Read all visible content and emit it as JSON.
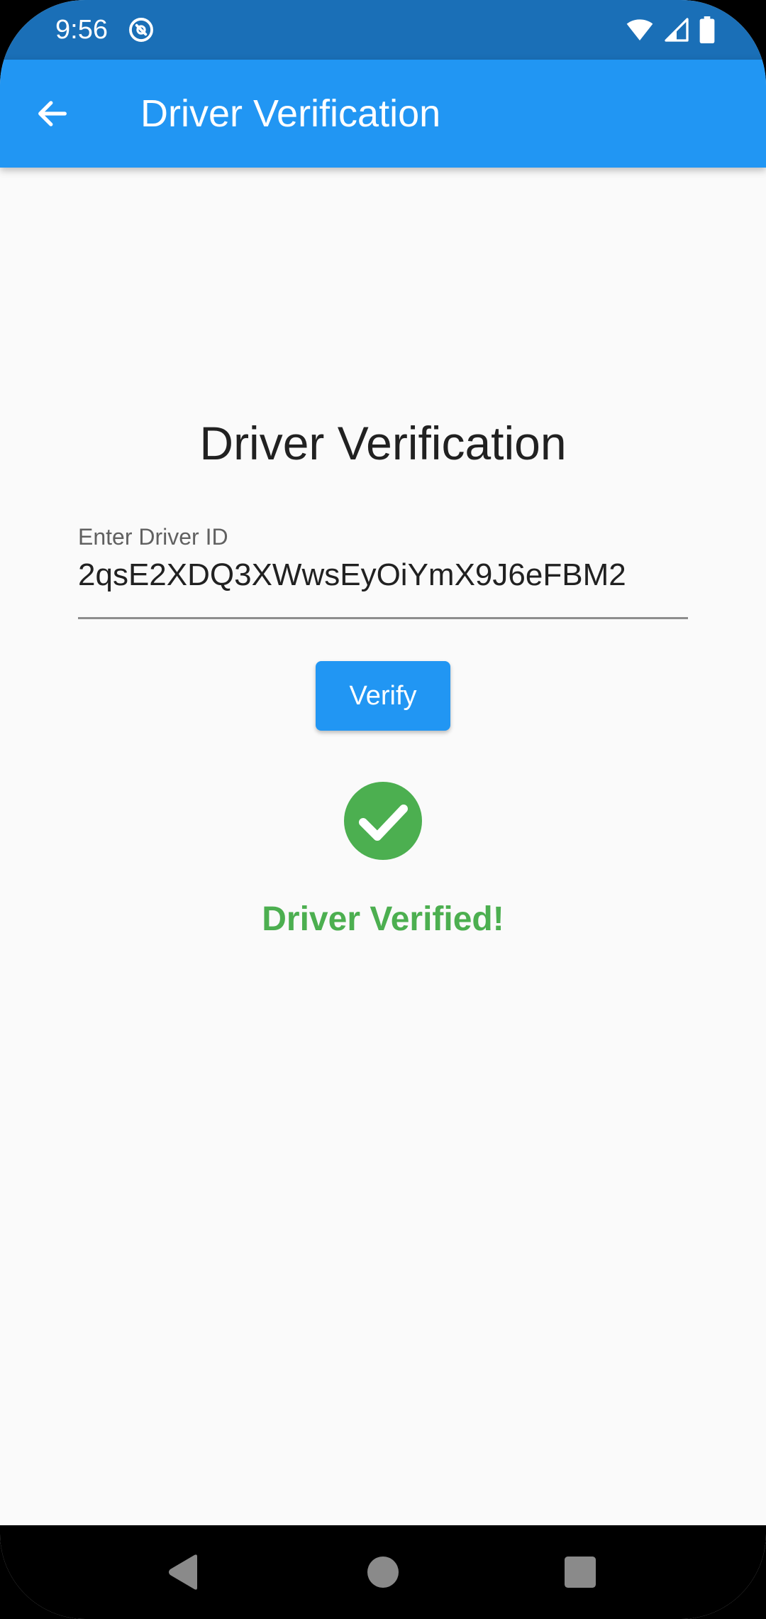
{
  "status_bar": {
    "time": "9:56",
    "icons": [
      "sync-icon",
      "wifi-icon",
      "signal-icon",
      "battery-icon"
    ]
  },
  "app_bar": {
    "title": "Driver Verification",
    "back_icon": "arrow-back-icon"
  },
  "main": {
    "heading": "Driver Verification",
    "driver_id_field": {
      "label": "Enter Driver ID",
      "value": "2qsE2XDQ3XWwsEyOiYmX9J6eFBM2"
    },
    "verify_button_label": "Verify",
    "result": {
      "icon": "check-circle-icon",
      "message": "Driver Verified!"
    }
  },
  "nav_bar": {
    "buttons": [
      "back-triangle-icon",
      "home-circle-icon",
      "recents-square-icon"
    ]
  },
  "colors": {
    "status_bar": "#1a6fb7",
    "app_bar": "#2196f3",
    "primary": "#2196f3",
    "success": "#4caf50",
    "background": "#fafafa"
  }
}
